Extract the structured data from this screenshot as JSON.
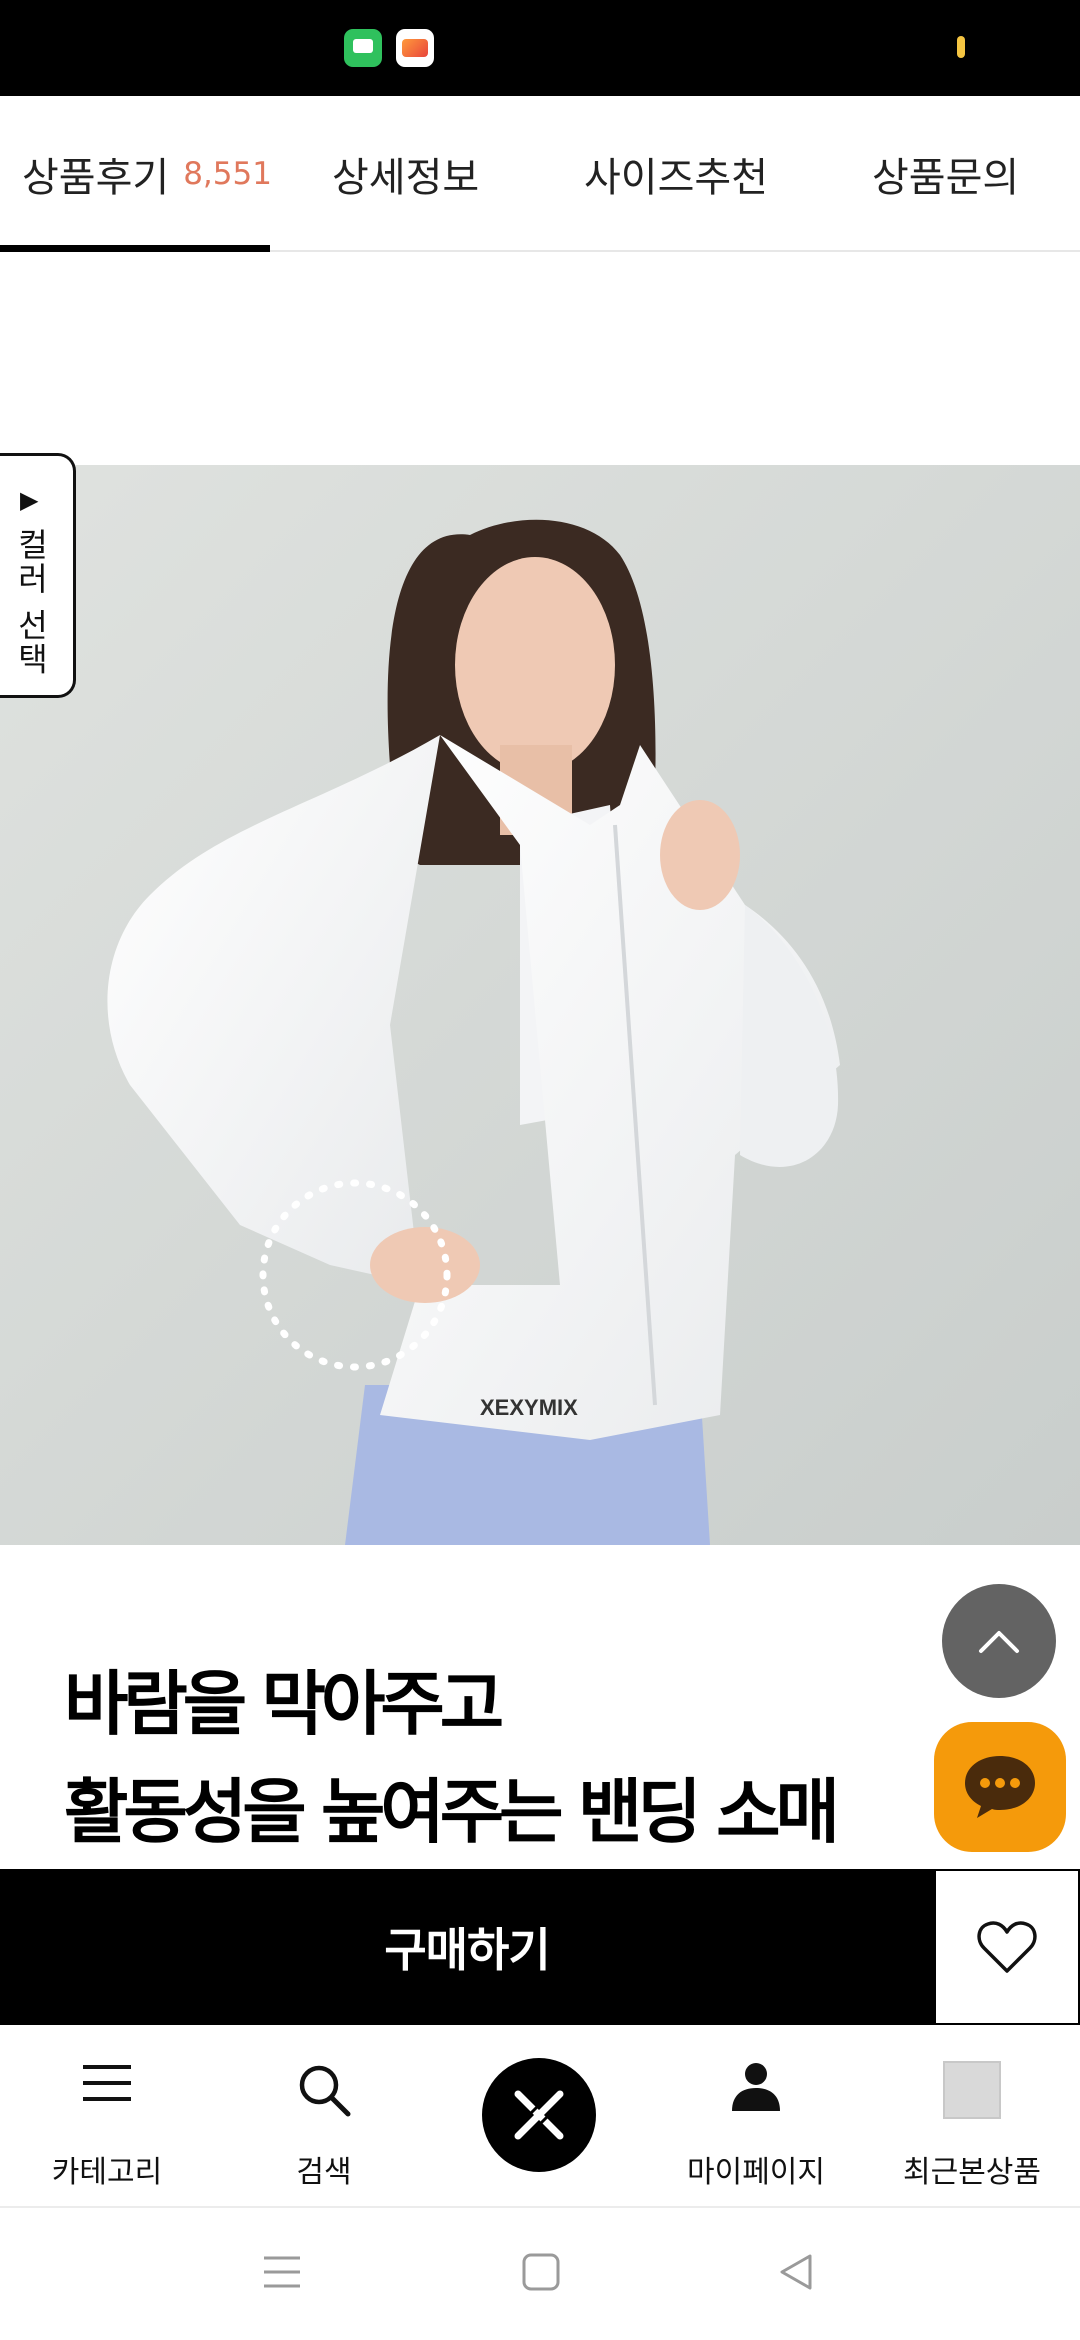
{
  "status_bar": {
    "icons": [
      "messages-app-icon",
      "gallery-app-icon",
      "battery-icon"
    ]
  },
  "tabs": [
    {
      "label": "상품후기",
      "count": "8,551",
      "active": true
    },
    {
      "label": "상세정보",
      "active": false
    },
    {
      "label": "사이즈추천",
      "active": false
    },
    {
      "label": "상품문의",
      "active": false
    }
  ],
  "side_tab": {
    "label": "컬러 선택",
    "icon": "play-arrow-icon"
  },
  "product_image": {
    "logo_text": "XEXYMIX"
  },
  "headline": {
    "line1": "바람을 막아주고",
    "line2": "활동성을 높여주는 밴딩 소매"
  },
  "actions": {
    "buy_label": "구매하기",
    "wish_icon": "heart-icon"
  },
  "floating": {
    "scroll_top_icon": "chevron-up-icon",
    "chat_icon": "chat-bubble-icon"
  },
  "bottom_nav": [
    {
      "label": "카테고리",
      "icon": "menu-icon"
    },
    {
      "label": "검색",
      "icon": "search-icon"
    },
    {
      "label": "",
      "icon": "brand-logo-icon"
    },
    {
      "label": "마이페이지",
      "icon": "person-icon"
    },
    {
      "label": "최근본상품",
      "icon": "recent-thumbnail"
    }
  ],
  "system_nav": [
    "recents-icon",
    "home-icon",
    "back-icon"
  ],
  "colors": {
    "accent_count": "#e0785c",
    "chat_orange": "#f59a0b",
    "primary_black": "#000000"
  }
}
